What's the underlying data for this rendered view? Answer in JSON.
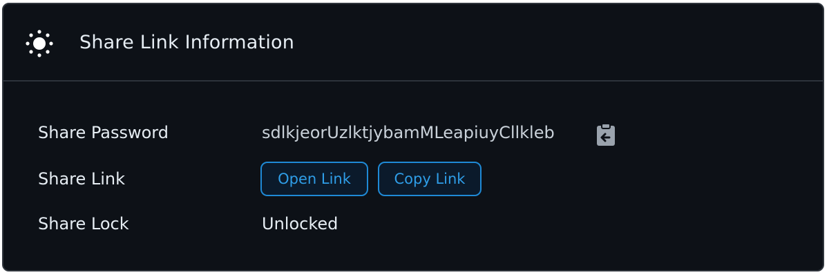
{
  "header": {
    "icon": "sun-icon",
    "title": "Share Link Information"
  },
  "rows": {
    "password": {
      "label": "Share Password",
      "value": "sdlkjeorUzlktjybamMLeapiuyCllkleb",
      "action_icon": "clipboard-copy-icon"
    },
    "link": {
      "label": "Share Link",
      "open_label": "Open Link",
      "copy_label": "Copy Link"
    },
    "lock": {
      "label": "Share Lock",
      "value": "Unlocked"
    }
  },
  "colors": {
    "background": "#0d1117",
    "border": "#30363d",
    "accent": "#2f9ee8",
    "text": "#e6edf3"
  }
}
